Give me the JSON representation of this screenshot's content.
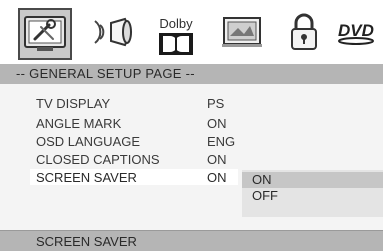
{
  "toolbar": {
    "items": [
      {
        "name": "general-setup",
        "icon": "settings-tools-icon",
        "selected": true
      },
      {
        "name": "audio-setup",
        "icon": "speaker-icon",
        "selected": false
      },
      {
        "name": "dolby-setup",
        "icon": "dolby-icon",
        "label": "Dolby",
        "selected": false
      },
      {
        "name": "video-setup",
        "icon": "video-picture-icon",
        "selected": false
      },
      {
        "name": "preference",
        "icon": "lock-icon",
        "selected": false
      },
      {
        "name": "dvd-setup",
        "icon": "dvd-logo-icon",
        "selected": false
      }
    ]
  },
  "header": {
    "title": "-- GENERAL SETUP  PAGE --"
  },
  "settings": [
    {
      "label": "TV DISPLAY",
      "value": "PS"
    },
    {
      "label": "ANGLE MARK",
      "value": "ON"
    },
    {
      "label": "OSD LANGUAGE",
      "value": "ENG"
    },
    {
      "label": "CLOSED CAPTIONS",
      "value": "ON"
    },
    {
      "label": "SCREEN SAVER",
      "value": "ON",
      "highlighted": true
    }
  ],
  "options": [
    {
      "label": "ON",
      "selected": true
    },
    {
      "label": "OFF",
      "selected": false
    }
  ],
  "footer": {
    "text": "SCREEN SAVER"
  },
  "colors": {
    "background": "#f4f4f4",
    "bar": "#b5b5b5",
    "highlight": "#ffffff",
    "option_active": "#c6c6c6"
  }
}
